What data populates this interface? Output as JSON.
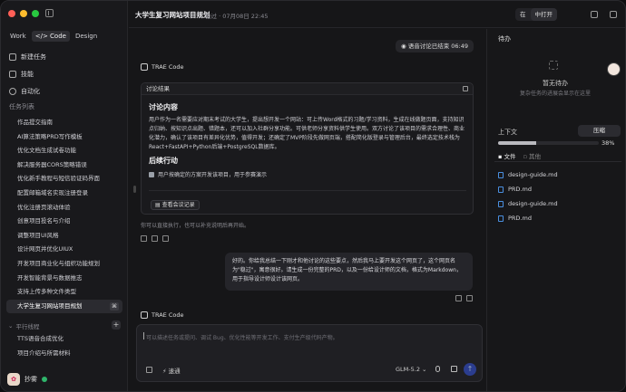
{
  "sidebar": {
    "modes": [
      "Work",
      "</> Code",
      "Design"
    ],
    "active_mode": 1,
    "nav": [
      "新建任务",
      "技能",
      "自动化"
    ],
    "section_title": "任务列表",
    "tasks": [
      "作品提交指南",
      "AI算法策略PRD写作模板",
      "优化文档生成试卷功能",
      "解决服务器CORS策略错误",
      "优化新手教程与短信验证码界面",
      "配置邮箱域名实现注册登录",
      "优化注册页滚动体验",
      "创意项目投名与介绍",
      "调整项目UI风格",
      "设计网页并优化UIUX",
      "开发项目商业化与组织功能规划",
      "开发智能背景与数据推志",
      "支持上传多种文件类型",
      "大学生复习网站项目规划"
    ],
    "active_task_tag": "⌘",
    "group_label": "平行线程",
    "group_tasks": [
      "TTS语音合成优化",
      "项目介绍与所需材料"
    ],
    "user_name": "抄雾"
  },
  "topbar": {
    "title": "大学生复习网站项目规划",
    "meta": "稳过 · 07月08日 22:45",
    "seg_left": "在",
    "seg_right": "中打开"
  },
  "chat": {
    "pill": "语音讨论已结束 06:49",
    "ai_name": "TRAE Code",
    "card_title": "讨论结果",
    "h_content": "讨论内容",
    "content": "用户作为一名需要应对期末考试的大学生，提出想开发一个网站：可上传Word格式的习题/学习资料，生成在线做题页面，支持知识点归纳、按知识点出题、错题本，还可以加入社群分享功能。可供老师分享资料供学生使用。双方讨论了该项目的需求合理性、商业化潜力，确认了该项目有差异化优势，值得开发；还确定了MVP阶段先做网页端，搭配简化版登录与管理后台，最终选定技术栈为React+FastAPI+Python后端+PostgreSQL数据库。",
    "h_follow": "后续行动",
    "follow_item": "用户按确定的方案开发该项目，用于参赛演示",
    "view_btn": "查看会议记录",
    "hint": "你可以直接执行，也可以补充说明后再开始。",
    "user_msg": "好的。你给我总结一下刚才和他讨论的这些要点，然后我马上要开发这个网页了，这个网页名为\"稳过\"，寓意很好。请生成一份完整的PRD，以及一份给设计师的文档，格式为Markdown，用于指导设计师设计该网页。",
    "ai_name2": "TRAE Code",
    "input_placeholder": "可以描述任务或提问、调试 Bug、优化性能等开发工作、支付生产级代码产物。",
    "mode_label": "速通",
    "model_label": "GLM-5.2 ⌄"
  },
  "rpanel": {
    "title": "待办",
    "empty_title": "暂无待办",
    "empty_sub": "复杂任务的进展会显示在这里",
    "ctx_label": "上下文",
    "ctx_btn": "压缩",
    "ctx_value": 38,
    "ctx_pct": "38%",
    "tab_files": "文件",
    "tab_other": "其他",
    "files": [
      "design-guide.md",
      "PRD.md",
      "design-guide.md",
      "PRD.md"
    ],
    "file_icon": "document-icon"
  },
  "colors": {
    "close": "#ff5f57",
    "min": "#febc2e",
    "max": "#28c840",
    "send": "#2b3d8f"
  }
}
